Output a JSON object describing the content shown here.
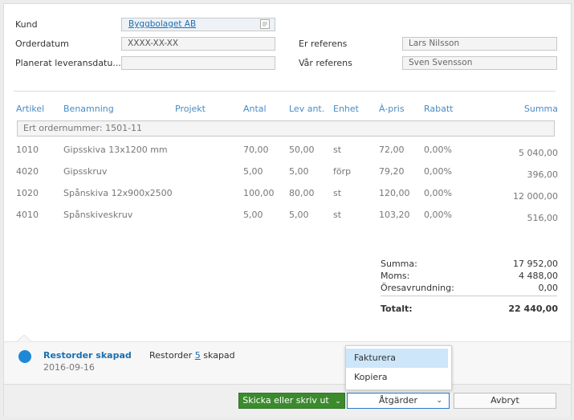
{
  "header": {
    "kund_label": "Kund",
    "kund_value": "Byggbolaget AB",
    "orderdatum_label": "Orderdatum",
    "orderdatum_value": "XXXX-XX-XX",
    "leverans_label": "Planerat leveransdatu...",
    "leverans_value": "",
    "er_ref_label": "Er referens",
    "er_ref_value": "Lars Nilsson",
    "var_ref_label": "Vår referens",
    "var_ref_value": "Sven Svensson"
  },
  "table": {
    "columns": [
      "Artikel",
      "Benamning",
      "Projekt",
      "Antal",
      "Lev ant.",
      "Enhet",
      "À-pris",
      "Rabatt",
      "Summa"
    ],
    "order_number": "Ert ordernummer: 1501-11",
    "rows": [
      {
        "artikel": "1010",
        "benamning": "Gipsskiva 13x1200 mm",
        "projekt": "",
        "antal": "70,00",
        "lev": "50,00",
        "enhet": "st",
        "apris": "72,00",
        "rabatt": "0,00%",
        "summa": "5 040,00"
      },
      {
        "artikel": "4020",
        "benamning": "Gipsskruv",
        "projekt": "",
        "antal": "5,00",
        "lev": "5,00",
        "enhet": "förp",
        "apris": "79,20",
        "rabatt": "0,00%",
        "summa": "396,00"
      },
      {
        "artikel": "1020",
        "benamning": "Spånskiva 12x900x2500",
        "projekt": "",
        "antal": "100,00",
        "lev": "80,00",
        "enhet": "st",
        "apris": "120,00",
        "rabatt": "0,00%",
        "summa": "12 000,00"
      },
      {
        "artikel": "4010",
        "benamning": "Spånskiveskruv",
        "projekt": "",
        "antal": "5,00",
        "lev": "5,00",
        "enhet": "st",
        "apris": "103,20",
        "rabatt": "0,00%",
        "summa": "516,00"
      }
    ]
  },
  "totals": {
    "summa_label": "Summa:",
    "summa_value": "17 952,00",
    "moms_label": "Moms:",
    "moms_value": "4 488,00",
    "ores_label": "Öresavrundning:",
    "ores_value": "0,00",
    "total_label": "Totalt:",
    "total_value": "22 440,00"
  },
  "timeline": {
    "title": "Restorder skapad",
    "date": "2016-09-16",
    "text_before": "Restorder",
    "link": "5",
    "text_after": "skapad",
    "dot_color": "#1e88d8"
  },
  "dropdown": {
    "items": [
      "Fakturera",
      "Kopiera"
    ]
  },
  "footer": {
    "send_label": "Skicka eller skriv ut",
    "actions_label": "Åtgärder",
    "cancel_label": "Avbryt"
  }
}
